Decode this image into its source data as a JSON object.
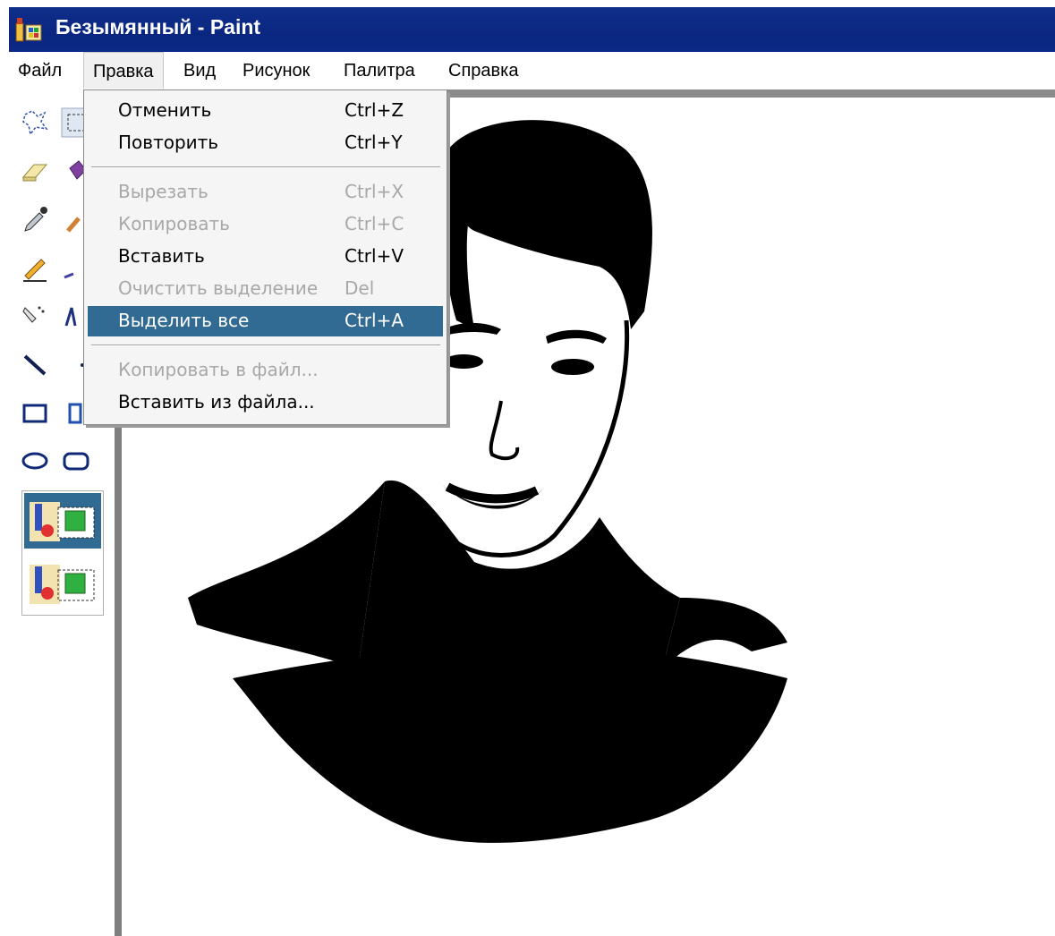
{
  "window": {
    "title": "Безымянный - Paint",
    "icon": "paint-app-icon"
  },
  "menubar": {
    "items": [
      {
        "label": "Файл"
      },
      {
        "label": "Правка",
        "open": true
      },
      {
        "label": "Вид"
      },
      {
        "label": "Рисунок"
      },
      {
        "label": "Палитра"
      },
      {
        "label": "Справка"
      }
    ]
  },
  "edit_menu": {
    "items": [
      {
        "label": "Отменить",
        "shortcut": "Ctrl+Z",
        "enabled": true
      },
      {
        "label": "Повторить",
        "shortcut": "Ctrl+Y",
        "enabled": true
      },
      {
        "label": "Вырезать",
        "shortcut": "Ctrl+X",
        "enabled": false
      },
      {
        "label": "Копировать",
        "shortcut": "Ctrl+C",
        "enabled": false
      },
      {
        "label": "Вставить",
        "shortcut": "Ctrl+V",
        "enabled": true
      },
      {
        "label": "Очистить выделение",
        "shortcut": "Del",
        "enabled": false
      },
      {
        "label": "Выделить все",
        "shortcut": "Ctrl+A",
        "enabled": true,
        "highlighted": true
      },
      {
        "label": "Копировать в файл...",
        "shortcut": "",
        "enabled": false
      },
      {
        "label": "Вставить из файла...",
        "shortcut": "",
        "enabled": true
      }
    ]
  },
  "toolbox": {
    "tools": [
      "free-select-icon",
      "rect-select-icon",
      "eraser-icon",
      "fill-icon",
      "color-picker-icon",
      "magnifier-icon",
      "pencil-icon",
      "brush-icon",
      "airbrush-icon",
      "text-icon",
      "line-icon",
      "curve-icon",
      "rectangle-icon",
      "polygon-icon",
      "ellipse-icon",
      "rounded-rect-icon"
    ],
    "selection_modes": [
      "opaque-selection-icon",
      "transparent-selection-icon"
    ]
  },
  "colors": {
    "titlebar": "#0a2680",
    "menu_highlight": "#316a93",
    "disabled_text": "#a8a8a8"
  }
}
